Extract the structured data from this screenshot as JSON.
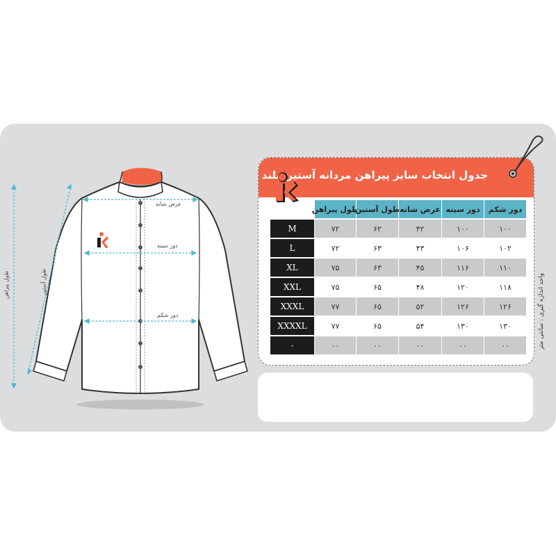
{
  "title": "جدول انتخاب سایز پیراهن مردانه آستین بلند",
  "unit_note": "واحد اندازه گیری : سانتی متر",
  "table": {
    "headers": [
      "دور شکم",
      "دور سینه",
      "عرض شانه",
      "طول آستین",
      "طول پیراهن"
    ],
    "rows": [
      {
        "size": "M",
        "values": [
          "۱۰۰",
          "۱۰۰",
          "۴۲",
          "۶۲",
          "۷۲"
        ]
      },
      {
        "size": "L",
        "values": [
          "۱۰۲",
          "۱۰۶",
          "۴۳",
          "۶۳",
          "۷۲"
        ]
      },
      {
        "size": "XL",
        "values": [
          "۱۱۰",
          "۱۱۶",
          "۴۵",
          "۶۳",
          "۷۵"
        ]
      },
      {
        "size": "XXL",
        "values": [
          "۱۱۸",
          "۱۲۰",
          "۴۸",
          "۶۵",
          "۷۵"
        ]
      },
      {
        "size": "XXXL",
        "values": [
          "۱۲۶",
          "۱۲۶",
          "۵۲",
          "۶۵",
          "۷۷"
        ]
      },
      {
        "size": "XXXXL",
        "values": [
          "۱۳۰",
          "۱۳۰",
          "۵۴",
          "۶۵",
          "۷۷"
        ]
      },
      {
        "size": "۰",
        "values": [
          "۰۰",
          "۰۰",
          "۰۰",
          "۰۰",
          "۰۰"
        ]
      }
    ]
  },
  "measurements": {
    "shoulder": "عرض شانه",
    "chest": "دور سینه",
    "waist": "دور شکم",
    "sleeve": "طول آستین",
    "shirt_length": "طول پیراهن"
  },
  "colors": {
    "accent": "#f06346",
    "header_teal": "#5bb3c6",
    "size_column": "#1c1c1e",
    "panel": "#dcdddf",
    "measure_line": "#4fb8d0"
  },
  "icons": {
    "logo": "k-person-logo",
    "tag": "hang-tag-icon"
  }
}
